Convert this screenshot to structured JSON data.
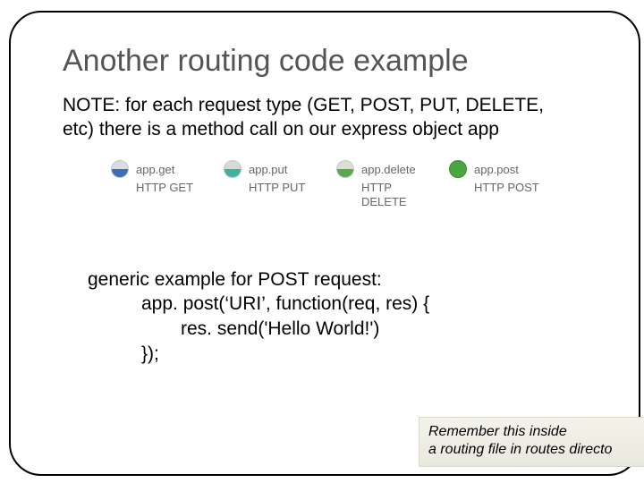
{
  "title": "Another routing code example",
  "note": "NOTE: for each request type (GET, POST, PUT, DELETE, etc) there is a method call on our express object app",
  "methods": [
    {
      "name": "app.get",
      "http": "HTTP GET",
      "circle": "half-blue"
    },
    {
      "name": "app.put",
      "http": "HTTP PUT",
      "circle": "half-teal"
    },
    {
      "name": "app.delete",
      "http": "HTTP\nDELETE",
      "circle": "half-green"
    },
    {
      "name": "app.post",
      "http": "HTTP POST",
      "circle": "full-green"
    }
  ],
  "example": {
    "heading": "generic example for POST request:",
    "line1": "app. post(‘URI’, function(req, res) {",
    "line2": "res. send('Hello World!')",
    "line3": "});"
  },
  "remember": "Remember this inside\na routing file in routes directo"
}
